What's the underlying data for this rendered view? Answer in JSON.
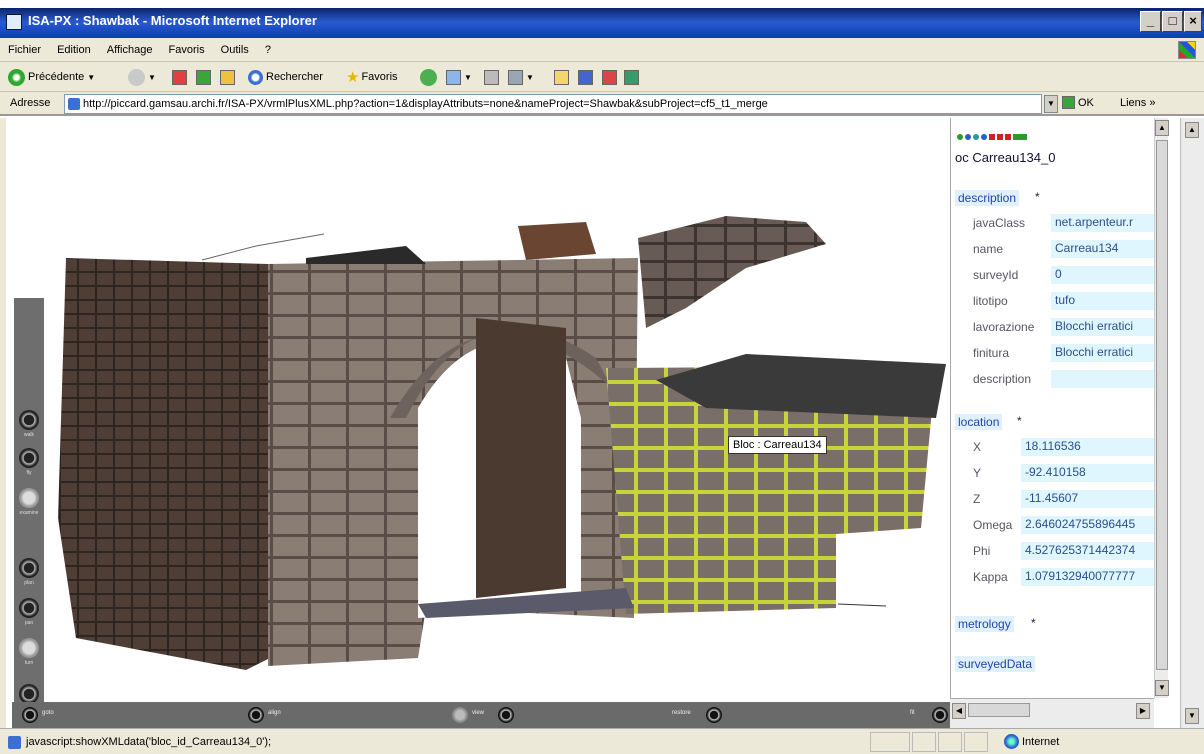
{
  "window": {
    "title": "ISA-PX : Shawbak - Microsoft Internet Explorer"
  },
  "menu": {
    "items": [
      "Fichier",
      "Edition",
      "Affichage",
      "Favoris",
      "Outils",
      "?"
    ]
  },
  "toolbar": {
    "back_label": "Précédente",
    "search_label": "Rechercher",
    "favorites_label": "Favoris"
  },
  "address": {
    "label": "Adresse",
    "url": "http://piccard.gamsau.archi.fr/ISA-PX/vrmlPlusXML.php?action=1&displayAttributs=none&nameProject=Shawbak&subProject=cf5_t1_merge",
    "go_label": "OK",
    "links_label": "Liens"
  },
  "viewer": {
    "tooltip": "Bloc : Carreau134",
    "sidebar_labels": [
      "walk",
      "fly",
      "examine",
      "plan",
      "pan",
      "turn",
      "roll"
    ],
    "bottom_labels": [
      "goto",
      "align",
      "view",
      "restore",
      "fit"
    ]
  },
  "panel": {
    "node_title": "oc Carreau134_0",
    "sections": {
      "description": "description",
      "location": "location",
      "metrology": "metrology",
      "surveyedData": "surveyedData"
    },
    "star": "*",
    "description_attrs": [
      {
        "name": "javaClass",
        "value": "net.arpenteur.r"
      },
      {
        "name": "name",
        "value": "Carreau134"
      },
      {
        "name": "surveyId",
        "value": "0"
      },
      {
        "name": "litotipo",
        "value": "tufo"
      },
      {
        "name": "lavorazione",
        "value": "Blocchi erratici"
      },
      {
        "name": "finitura",
        "value": "Blocchi erratici"
      },
      {
        "name": "description",
        "value": ""
      }
    ],
    "location_attrs": [
      {
        "name": "X",
        "value": "18.116536"
      },
      {
        "name": "Y",
        "value": "-92.410158"
      },
      {
        "name": "Z",
        "value": "-11.45607"
      },
      {
        "name": "Omega",
        "value": "2.646024755896445"
      },
      {
        "name": "Phi",
        "value": "4.527625371442374"
      },
      {
        "name": "Kappa",
        "value": "1.079132940077777"
      }
    ]
  },
  "status": {
    "text": "javascript:showXMLdata('bloc_id_Carreau134_0');",
    "zone": "Internet"
  },
  "colors": {
    "titlebar": "#0a3fb0",
    "chrome": "#ece9d8",
    "highlight": "#d8e84a",
    "stone": "#8a7d74",
    "link": "#2a4f8c"
  }
}
